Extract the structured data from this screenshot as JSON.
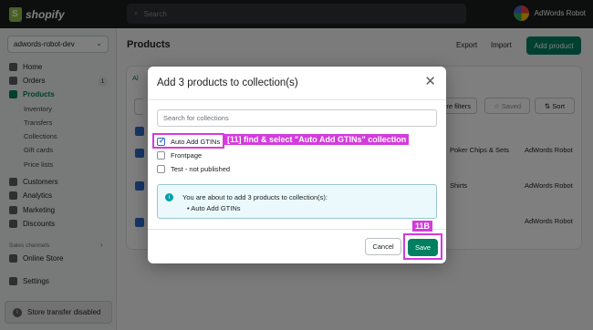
{
  "topbar": {
    "logo_text": "shopify",
    "search_placeholder": "Search",
    "user_name": "AdWords Robot"
  },
  "sidebar": {
    "store_name": "adwords-robot-dev",
    "items": [
      {
        "label": "Home"
      },
      {
        "label": "Orders",
        "badge": "1"
      },
      {
        "label": "Products"
      },
      {
        "label": "Customers"
      },
      {
        "label": "Analytics"
      },
      {
        "label": "Marketing"
      },
      {
        "label": "Discounts"
      }
    ],
    "product_sub": [
      "Inventory",
      "Transfers",
      "Collections",
      "Gift cards",
      "Price lists"
    ],
    "sales_channels_label": "Sales channels",
    "online_store": "Online Store",
    "settings": "Settings",
    "store_transfer": "Store transfer disabled"
  },
  "page": {
    "title": "Products",
    "export": "Export",
    "import": "Import",
    "add_product": "Add product",
    "more_filters": "ore filters",
    "saved": "Saved",
    "sort": "Sort",
    "tab_partial": "Al",
    "rows": [
      {
        "type": "Poker Chips & Sets",
        "vendor": "AdWords Robot"
      },
      {
        "type": "Shirts",
        "vendor": "AdWords Robot"
      },
      {
        "type": "",
        "vendor": "AdWords Robot"
      }
    ]
  },
  "modal": {
    "title": "Add 3 products to collection(s)",
    "search_placeholder": "Search for collections",
    "options": [
      {
        "label": "Auto Add GTINs",
        "checked": true
      },
      {
        "label": "Frontpage",
        "checked": false
      },
      {
        "label": "Test - not published",
        "checked": false
      }
    ],
    "info_text": "You are about to add 3 products to collection(s):",
    "info_bullet": "• Auto Add GTINs",
    "cancel": "Cancel",
    "save": "Save"
  },
  "annotations": {
    "step_11": "[11] find & select \"Auto Add GTINs\" collection",
    "step_11b": "11B"
  }
}
